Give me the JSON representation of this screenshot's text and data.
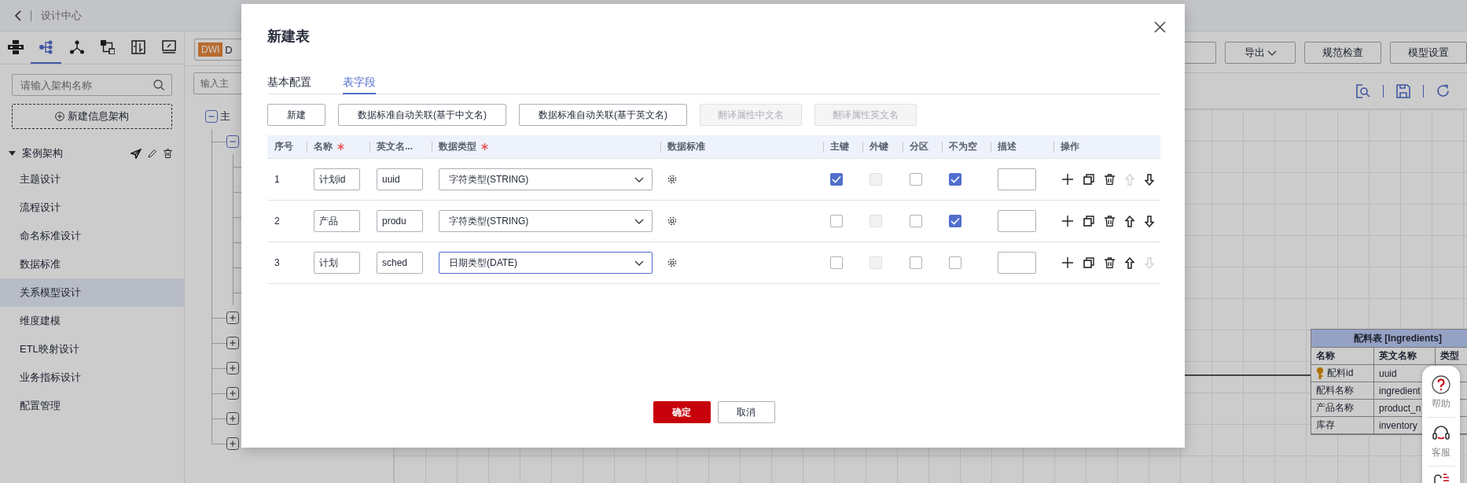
{
  "top_bar": {
    "title": "设计中心"
  },
  "sidebar": {
    "icon_tabs": [
      {
        "kind": "cluster",
        "selected": false
      },
      {
        "kind": "tree",
        "selected": true
      },
      {
        "kind": "network",
        "selected": false
      },
      {
        "kind": "flow",
        "selected": false
      },
      {
        "kind": "book",
        "selected": false
      },
      {
        "kind": "monitor",
        "selected": false
      }
    ],
    "search": {
      "placeholder": "请输入架构名称"
    },
    "new_button": "新建信息架构",
    "tree": {
      "label": "案例架构",
      "expanded": true,
      "children": [
        {
          "label": "主题设计",
          "selected": false
        },
        {
          "label": "流程设计",
          "selected": false
        },
        {
          "label": "命名标准设计",
          "selected": false
        },
        {
          "label": "数据标准",
          "selected": false
        },
        {
          "label": "关系模型设计",
          "selected": true
        },
        {
          "label": "维度建模",
          "selected": false
        },
        {
          "label": "ETL映射设计",
          "selected": false
        },
        {
          "label": "业务指标设计",
          "selected": false
        },
        {
          "label": "配置管理",
          "selected": false
        }
      ]
    }
  },
  "middle_panel": {
    "badge": "DWI",
    "badge_text": "D",
    "search": {
      "placeholder": "输入主"
    },
    "tree": {
      "label": "主",
      "expanded": true,
      "children": [
        {
          "expanded": true
        },
        {
          "expanded": false
        },
        {
          "expanded": false
        },
        {
          "expanded": false
        },
        {
          "expanded": false
        },
        {
          "expanded": false
        },
        {
          "expanded": false
        }
      ]
    }
  },
  "toolbar": {
    "buttons": [
      {
        "label": "导出",
        "dropdown": true
      },
      {
        "label": "规范检查",
        "dropdown": false
      },
      {
        "label": "模型设置",
        "dropdown": false
      }
    ]
  },
  "canvas": {
    "entity": {
      "title": "配料表 [Ingredients]",
      "columns": [
        "名称",
        "英文名称",
        "类型"
      ],
      "rows": [
        {
          "name": "配料id",
          "english_name": "uuid",
          "primary_key": true
        },
        {
          "name": "配料名称",
          "english_name": "ingredient",
          "primary_key": false
        },
        {
          "name": "产品名称",
          "english_name": "product_n",
          "primary_key": false
        },
        {
          "name": "库存",
          "english_name": "inventory",
          "primary_key": false
        }
      ]
    }
  },
  "help_widget": {
    "items": [
      {
        "kind": "help",
        "label": "帮助"
      },
      {
        "kind": "service",
        "label": "客服"
      },
      {
        "kind": "feedback"
      }
    ]
  },
  "dialog": {
    "title": "新建表",
    "tabs": [
      {
        "label": "基本配置",
        "selected": false
      },
      {
        "label": "表字段",
        "selected": true
      }
    ],
    "buttons": [
      {
        "label": "新建",
        "disabled": false
      },
      {
        "label": "数据标准自动关联(基于中文名)",
        "disabled": false
      },
      {
        "label": "数据标准自动关联(基于英文名)",
        "disabled": false
      },
      {
        "label": "翻译属性中文名",
        "disabled": true
      },
      {
        "label": "翻译属性英文名",
        "disabled": true
      }
    ],
    "columns": [
      {
        "label": "序号",
        "required": false
      },
      {
        "label": "名称",
        "required": true
      },
      {
        "label": "英文名...",
        "required": false
      },
      {
        "label": "数据类型",
        "required": true
      },
      {
        "label": "数据标准",
        "required": false
      },
      {
        "label": "主键",
        "required": false
      },
      {
        "label": "外键",
        "required": false
      },
      {
        "label": "分区",
        "required": false
      },
      {
        "label": "不为空",
        "required": false
      },
      {
        "label": "描述",
        "required": false
      },
      {
        "label": "操作",
        "required": false
      }
    ],
    "rows": [
      {
        "index": "1",
        "name": "计划id",
        "english_name": "uuid",
        "data_type": "字符类型(STRING)",
        "focused": false,
        "primary_key": true,
        "foreign_key": false,
        "foreign_key_disabled": true,
        "partition": false,
        "not_null": true,
        "move_up_disabled": true,
        "move_down_disabled": false
      },
      {
        "index": "2",
        "name": "产品",
        "english_name": "produ",
        "data_type": "字符类型(STRING)",
        "focused": false,
        "primary_key": false,
        "foreign_key": false,
        "foreign_key_disabled": true,
        "partition": false,
        "not_null": true,
        "move_up_disabled": false,
        "move_down_disabled": false
      },
      {
        "index": "3",
        "name": "计划",
        "english_name": "sched",
        "data_type": "日期类型(DATE)",
        "focused": true,
        "primary_key": false,
        "foreign_key": false,
        "foreign_key_disabled": true,
        "partition": false,
        "not_null": false,
        "move_up_disabled": false,
        "move_down_disabled": true
      }
    ],
    "confirm": "确定",
    "cancel": "取消"
  }
}
